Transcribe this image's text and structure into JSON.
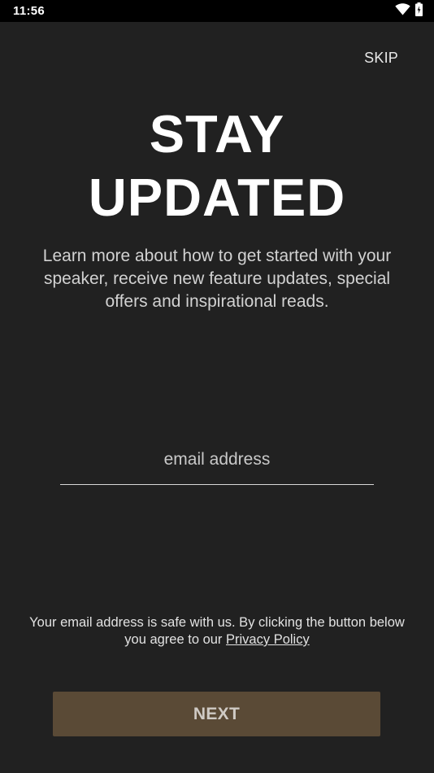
{
  "status_bar": {
    "time": "11:56",
    "icons": [
      "wifi-icon",
      "battery-icon"
    ]
  },
  "skip_label": "SKIP",
  "headline": {
    "line1": "STAY",
    "line2": "UPDATED"
  },
  "description": "Learn more about how to get started with your speaker, receive new feature updates, special offers and inspirational reads.",
  "email": {
    "placeholder": "email address",
    "value": ""
  },
  "disclaimer": {
    "text": "Your email address is safe with us. By clicking the button below you agree to our ",
    "link_label": "Privacy Policy"
  },
  "next_label": "NEXT",
  "colors": {
    "background": "#212121",
    "status_bar": "#000000",
    "button": "#5a4a36",
    "button_text": "#cfcac4"
  }
}
